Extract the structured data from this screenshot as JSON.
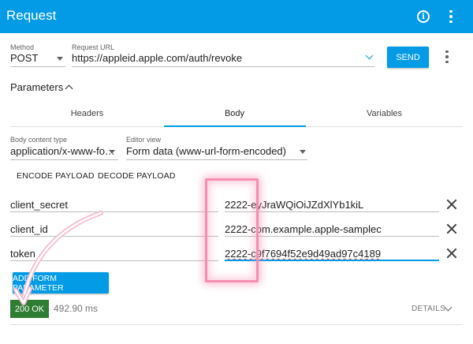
{
  "app": {
    "title": "Request",
    "icons": [
      "info-icon",
      "more-vert-icon"
    ],
    "accent": "#039be5"
  },
  "request": {
    "method_label": "Method",
    "method_value": "POST",
    "url_label": "Request URL",
    "url_value": "https://appleid.apple.com/auth/revoke",
    "send_label": "SEND"
  },
  "parameters": {
    "label": "Parameters",
    "tabs": [
      {
        "label": "Headers",
        "active": false
      },
      {
        "label": "Body",
        "active": true
      },
      {
        "label": "Variables",
        "active": false
      }
    ]
  },
  "body": {
    "content_type_label": "Body content type",
    "content_type_value": "application/x-www-fo…",
    "editor_label": "Editor view",
    "editor_value": "Form data (www-url-form-encoded)",
    "encode_label": "ENCODE PAYLOAD",
    "decode_label": "DECODE PAYLOAD",
    "params": [
      {
        "name": "client_secret",
        "value": "2222-eyJraWQiOiJZdXlYb1kiL"
      },
      {
        "name": "client_id",
        "value": "2222-com.example.apple-samplec"
      },
      {
        "name": "token",
        "value": "2222-c9f7694f52e9d49ad97c4189"
      }
    ],
    "add_label": "ADD FORM PARAMETER"
  },
  "response": {
    "status": "200 OK",
    "status_color": "#2e7d32",
    "time": "492.90 ms",
    "details_label": "DETAILS"
  },
  "annotation": {
    "highlight_color": "#f48fb1"
  }
}
